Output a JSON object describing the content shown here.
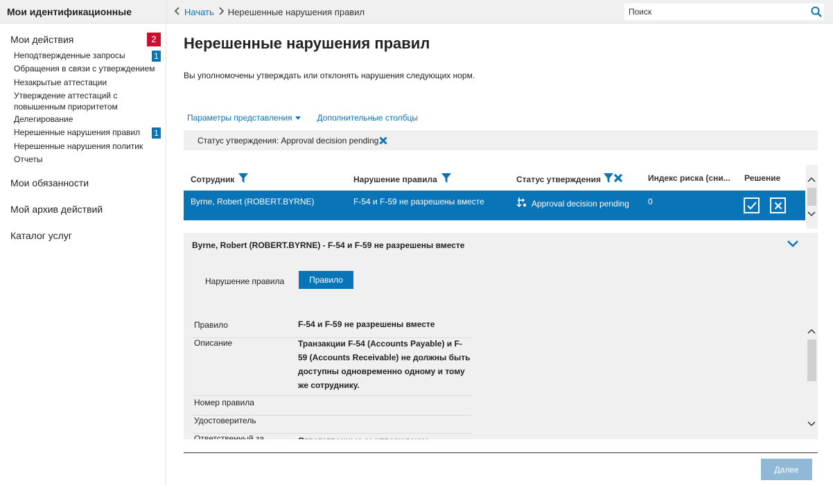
{
  "header": {
    "app_title": "Мои идентификационные",
    "breadcrumb": {
      "home": "Начать",
      "current": "Нерешенные нарушения правил"
    },
    "search_placeholder": "Поиск"
  },
  "sidebar": {
    "my_actions": {
      "label": "Мои действия",
      "badge": "2"
    },
    "items": [
      {
        "label": "Неподтвержденные запросы",
        "badge": "1"
      },
      {
        "label": "Обращения в связи с утверждением"
      },
      {
        "label": "Незакрытые аттестации"
      },
      {
        "label": "Утверждение аттестаций с повышенным приоритетом"
      },
      {
        "label": "Делегирование"
      },
      {
        "label": "Нерешенные нарушения правил",
        "badge": "1"
      },
      {
        "label": "Нерешенные нарушения политик"
      },
      {
        "label": "Отчеты"
      }
    ],
    "sections": [
      "Мои обязанности",
      "Мой архив действий",
      "Каталог услуг"
    ]
  },
  "main": {
    "title": "Нерешенные нарушения правил",
    "intro": "Вы уполномочены утверждать или отклонять нарушения следующих норм.",
    "view_options": "Параметры представления",
    "extra_columns": "Дополнительные столбцы",
    "filter": "Статус утверждения: Approval decision pending"
  },
  "table": {
    "columns": [
      "Сотрудник",
      "Нарушение правила",
      "Статус утверждения",
      "Индекс риска (сни...",
      "Решение"
    ],
    "rows": [
      {
        "employee": "Byrne, Robert (ROBERT.BYRNE)",
        "violation": "F-54 и F-59 не разрешены вместе",
        "status": "Approval decision pending",
        "risk": "0"
      }
    ]
  },
  "detail": {
    "title": "Byrne, Robert (ROBERT.BYRNE) - F-54 и F-59 не разрешены вместе",
    "tab_label": "Нарушение правила",
    "tab_button": "Правило",
    "fields": [
      {
        "key": "Правило",
        "value": "F-54 и F-59 не разрешены вместе"
      },
      {
        "key": "Описание",
        "value": "Транзакции F-54 (Accounts Payable) и F-59 (Accounts Receivable) не должны быть доступны одновременно одному и тому же сотруднику."
      },
      {
        "key": "Номер правила",
        "value": ""
      },
      {
        "key": "Удостоверитель",
        "value": ""
      },
      {
        "key": "Ответственный за",
        "value": "Ответственные за утверждение"
      }
    ]
  },
  "footer": {
    "next_label": "Далее"
  },
  "colors": {
    "accent": "#0a74b8",
    "badge_red": "#c8102e",
    "panel_bg": "#f0f0f0"
  }
}
